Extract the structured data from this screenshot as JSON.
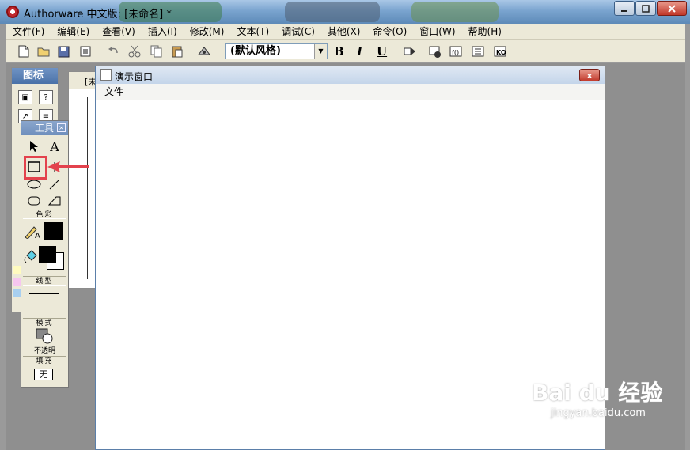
{
  "window": {
    "title": "Authorware 中文版: [未命名] *"
  },
  "menu": [
    "文件(F)",
    "编辑(E)",
    "查看(V)",
    "插入(I)",
    "修改(M)",
    "文本(T)",
    "调试(C)",
    "其他(X)",
    "命令(O)",
    "窗口(W)",
    "帮助(H)"
  ],
  "toolbar": {
    "style_value": "(默认风格)",
    "bold": "B",
    "italic": "I",
    "underline": "U",
    "icons": [
      "new-file-icon",
      "open-folder-icon",
      "save-all-icon",
      "import-icon",
      "undo-icon",
      "cut-icon",
      "copy-icon",
      "paste-icon",
      "find-icon",
      "run-icon",
      "control-panel-icon",
      "functions-icon",
      "variables-icon",
      "knowledge-objects-icon"
    ]
  },
  "icon_palette": {
    "title": "图标"
  },
  "flowline": {
    "title_partial": "[未"
  },
  "presentation": {
    "title": "演示窗口",
    "menu_label": "文件",
    "close_label": "x"
  },
  "tools": {
    "title": "工具",
    "text_tool": "A",
    "color_section": "色彩",
    "line_section": "线型",
    "mode_section": "模式",
    "mode_value": "不透明",
    "fill_section": "填充",
    "fill_value": "无"
  },
  "watermark": {
    "brand": "Bai du 经验",
    "url": "jingyan.baidu.com"
  },
  "colors": {
    "highlight": "#e3424d",
    "menubar": "#ece9d8",
    "title_blue": "#6f93c4"
  }
}
